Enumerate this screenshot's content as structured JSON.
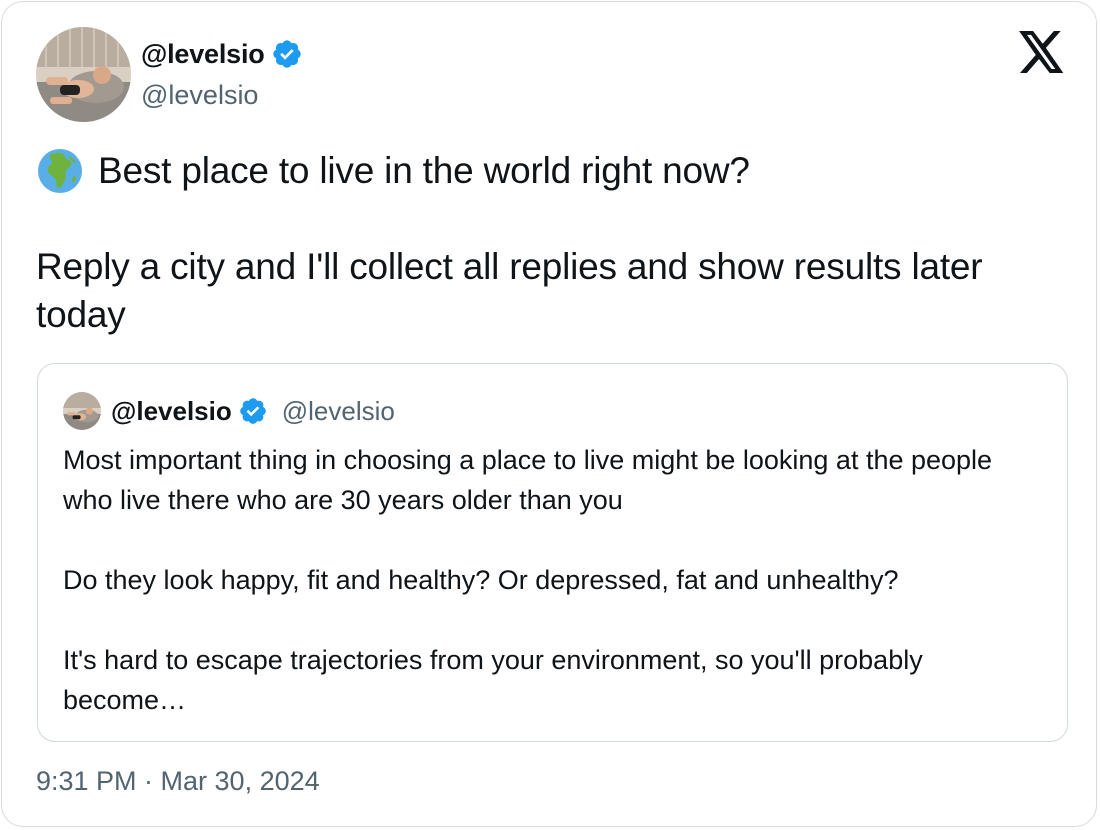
{
  "author": {
    "name": "@levelsio",
    "handle": "@levelsio",
    "verified": true
  },
  "tweet": {
    "line1": "Best place to live in the world right now?",
    "line2": "Reply a city and I'll collect all replies and show results later today"
  },
  "quoted_tweet": {
    "name": "@levelsio",
    "handle": "@levelsio",
    "verified": true,
    "paragraphs": [
      "Most important thing in choosing a place to live might be looking at the people who live there who are 30 years older than you",
      "Do they look happy, fit and healthy? Or depressed, fat and unhealthy?",
      "It's hard to escape trajectories from your environment, so you'll probably become…"
    ]
  },
  "timestamp": "9:31 PM · Mar 30, 2024",
  "icons": {
    "globe": "globe-africa-emoji",
    "verified": "verified-badge-icon",
    "brand": "x-logo-icon"
  },
  "colors": {
    "verified_blue": "#1d9bf0",
    "secondary_text": "#536471",
    "primary_text": "#0f1419",
    "border": "#cfd9de"
  }
}
